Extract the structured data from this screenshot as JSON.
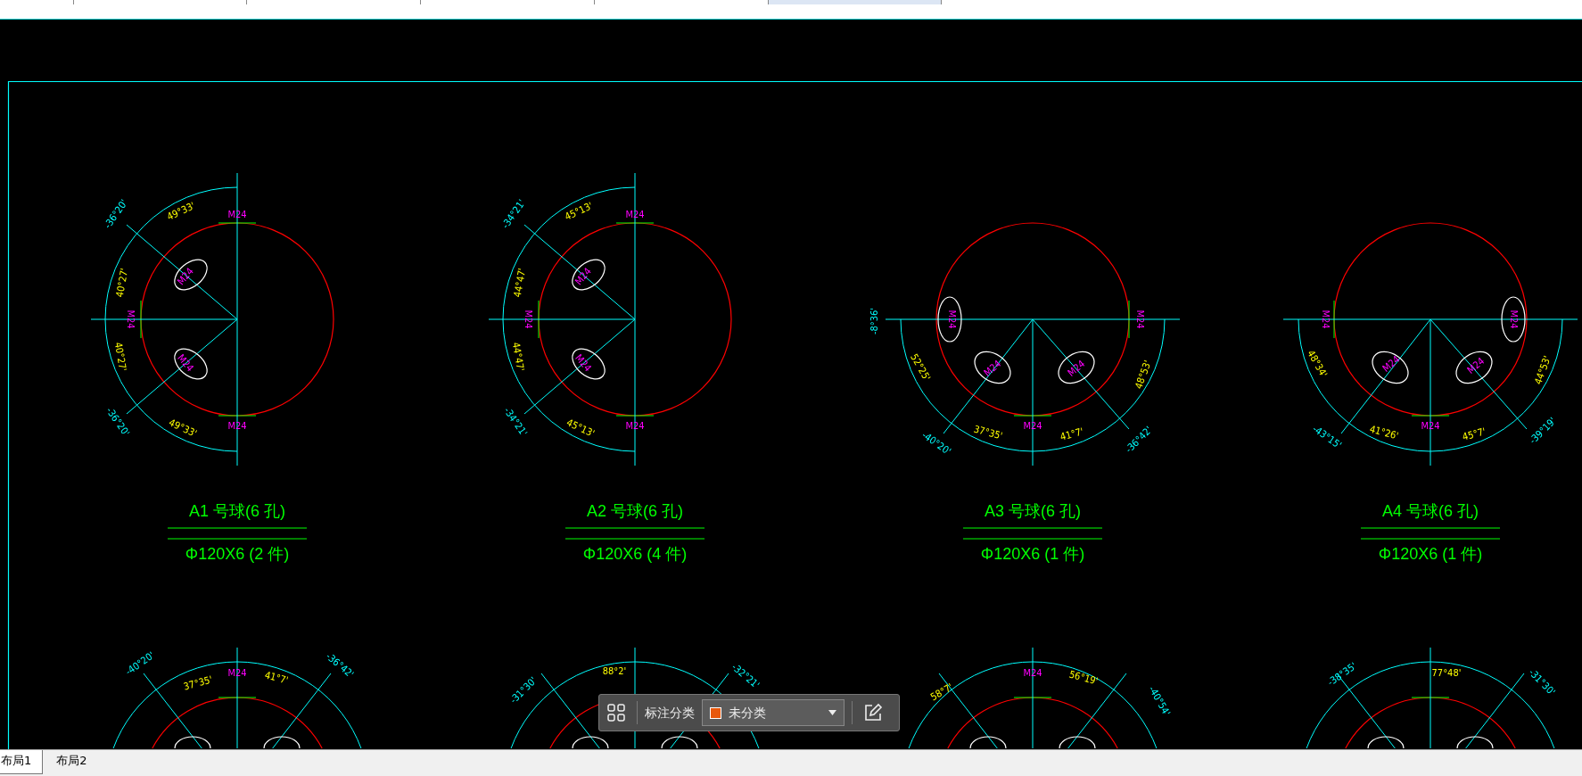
{
  "document_tabs": [
    {
      "selected": false
    },
    {
      "selected": false
    },
    {
      "selected": false
    },
    {
      "selected": false
    },
    {
      "selected": false
    },
    {
      "selected": true
    }
  ],
  "parts": [
    {
      "kind": "half-left",
      "title": "A1 号球(6 孔)",
      "spec": "Φ120X6 (2 件)",
      "annotations": [
        {
          "kind": "offset",
          "text": "-36°20'"
        },
        {
          "kind": "angle",
          "text": "49°33'"
        },
        {
          "kind": "bolt",
          "text": "M24"
        },
        {
          "kind": "angle",
          "text": "40°27'"
        },
        {
          "kind": "bolt",
          "text": "M24"
        },
        {
          "kind": "bolt",
          "text": "M24"
        },
        {
          "kind": "bolt",
          "text": "M24"
        },
        {
          "kind": "angle",
          "text": "40°27'"
        },
        {
          "kind": "offset",
          "text": "-36°20'"
        },
        {
          "kind": "angle",
          "text": "49°33'"
        },
        {
          "kind": "bolt",
          "text": "M24"
        }
      ]
    },
    {
      "kind": "half-left",
      "title": "A2 号球(6 孔)",
      "spec": "Φ120X6 (4 件)",
      "annotations": [
        {
          "kind": "offset",
          "text": "-34°21'"
        },
        {
          "kind": "angle",
          "text": "45°13'"
        },
        {
          "kind": "bolt",
          "text": "M24"
        },
        {
          "kind": "angle",
          "text": "44°47'"
        },
        {
          "kind": "bolt",
          "text": "M24"
        },
        {
          "kind": "bolt",
          "text": "M24"
        },
        {
          "kind": "bolt",
          "text": "M24"
        },
        {
          "kind": "angle",
          "text": "44°47'"
        },
        {
          "kind": "offset",
          "text": "-34°21'"
        },
        {
          "kind": "angle",
          "text": "45°13'"
        },
        {
          "kind": "bolt",
          "text": "M24"
        }
      ]
    },
    {
      "kind": "half-down-l",
      "title": "A3 号球(6 孔)",
      "spec": "Φ120X6 (1 件)",
      "annotations": [
        {
          "kind": "offset",
          "text": "-8°36'"
        },
        {
          "kind": "bolt",
          "text": "M24"
        },
        {
          "kind": "bolt",
          "text": "M24"
        },
        {
          "kind": "angle",
          "text": "52°25'"
        },
        {
          "kind": "bolt",
          "text": "M24"
        },
        {
          "kind": "bolt",
          "text": "M24"
        },
        {
          "kind": "angle",
          "text": "48°53'"
        },
        {
          "kind": "offset",
          "text": "-40°20'"
        },
        {
          "kind": "angle",
          "text": "37°35'"
        },
        {
          "kind": "bolt",
          "text": "M24"
        },
        {
          "kind": "angle",
          "text": "41°7'"
        },
        {
          "kind": "offset",
          "text": "-36°42'"
        }
      ]
    },
    {
      "kind": "half-down-r",
      "title": "A4 号球(6 孔)",
      "spec": "Φ120X6 (1 件)",
      "annotations": [
        {
          "kind": "bolt",
          "text": "M24"
        },
        {
          "kind": "bolt",
          "text": "M24"
        },
        {
          "kind": "angle",
          "text": "48°34'"
        },
        {
          "kind": "bolt",
          "text": "M24"
        },
        {
          "kind": "bolt",
          "text": "M24"
        },
        {
          "kind": "angle",
          "text": "44°53'"
        },
        {
          "kind": "offset",
          "text": "-43°15'"
        },
        {
          "kind": "angle",
          "text": "41°26'"
        },
        {
          "kind": "bolt",
          "text": "M24"
        },
        {
          "kind": "angle",
          "text": "45°7'"
        },
        {
          "kind": "offset",
          "text": "-39°19'"
        }
      ]
    },
    {
      "kind": "upper-arc",
      "annotations": [
        {
          "kind": "offset",
          "text": "-40°20'"
        },
        {
          "kind": "angle",
          "text": "37°35'"
        },
        {
          "kind": "bolt",
          "text": "M24"
        },
        {
          "kind": "angle",
          "text": "41°7'"
        },
        {
          "kind": "offset",
          "text": "-36°42'"
        }
      ]
    },
    {
      "kind": "upper-arc",
      "annotations": [
        {
          "kind": "offset",
          "text": "-31°30'"
        },
        {
          "kind": "angle",
          "text": "88°2'"
        },
        {
          "kind": "offset",
          "text": "-32°21'"
        }
      ]
    },
    {
      "kind": "upper-arc",
      "annotations": [
        {
          "kind": "angle",
          "text": "58°7'"
        },
        {
          "kind": "bolt",
          "text": "M24"
        },
        {
          "kind": "angle",
          "text": "56°19'"
        },
        {
          "kind": "offset",
          "text": "-40°54'"
        }
      ]
    },
    {
      "kind": "upper-arc",
      "annotations": [
        {
          "kind": "offset",
          "text": "-38°35'"
        },
        {
          "kind": "angle",
          "text": "77°48'"
        },
        {
          "kind": "offset",
          "text": "-31°30'"
        }
      ]
    }
  ],
  "toolbar": {
    "label": "标注分类",
    "category": {
      "label": "未分类",
      "color": "#e8580c"
    }
  },
  "layout_tabs": [
    {
      "label": "布局1",
      "selected": true
    },
    {
      "label": "布局2",
      "selected": false
    }
  ]
}
